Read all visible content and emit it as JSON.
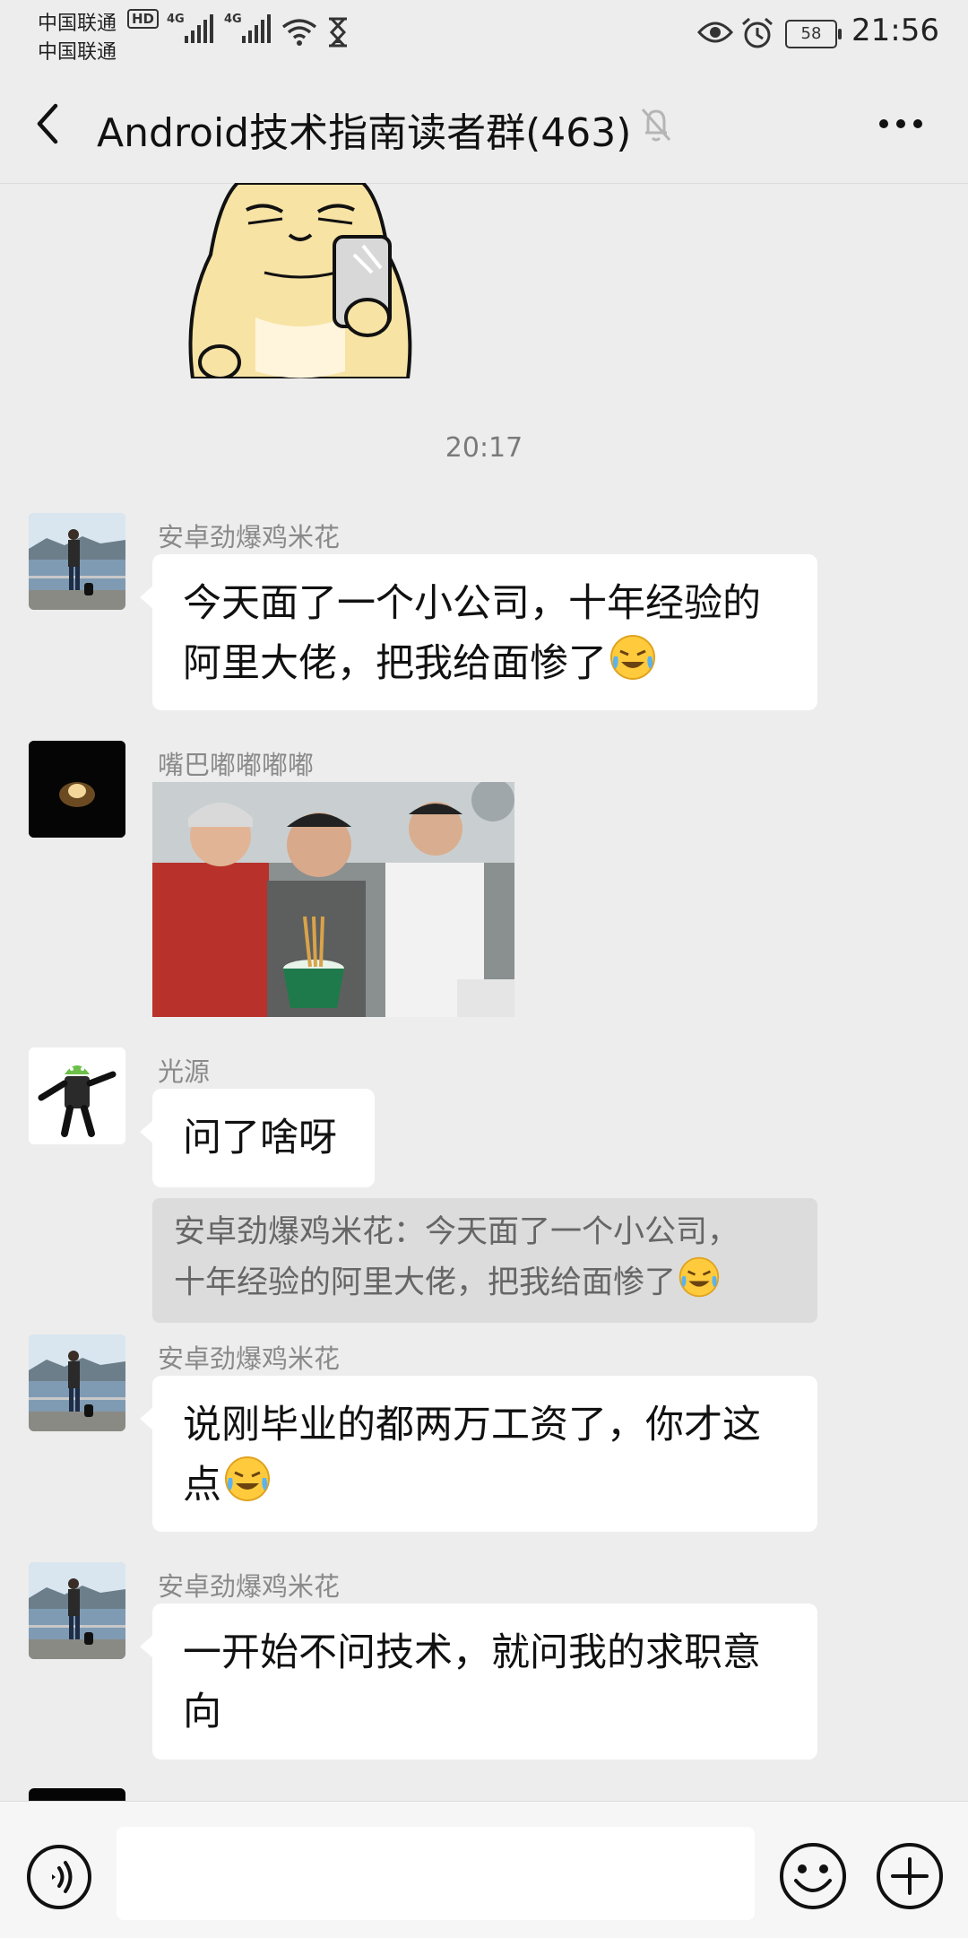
{
  "status_bar": {
    "carrier_1": "中国联通",
    "carrier_2": "中国联通",
    "hd_badge": "HD",
    "network_1": "4G",
    "network_2": "4G",
    "battery_level": "58",
    "time": "21:56",
    "icons": [
      "wifi-icon",
      "hourglass-icon",
      "eye-icon",
      "alarm-icon",
      "battery-icon"
    ]
  },
  "header": {
    "title": "Android技术指南读者群(463)",
    "icons": [
      "back-arrow-icon",
      "mute-bell-icon",
      "more-dots-icon"
    ]
  },
  "chat": {
    "timestamp": "20:17",
    "messages": [
      {
        "sender": "安卓劲爆鸡米花",
        "text_line1": "今天面了一个小公司，十年经验的",
        "text_line2": "阿里大佬，把我给面惨了"
      },
      {
        "sender": "嘴巴嘟嘟嘟嘟",
        "image": "photo-message"
      },
      {
        "sender": "光源",
        "text": "问了啥呀",
        "quote_line1": "安卓劲爆鸡米花：今天面了一个小公司，",
        "quote_line2": "十年经验的阿里大佬，把我给面惨了"
      },
      {
        "sender": "安卓劲爆鸡米花",
        "text_line1": "说刚毕业的都两万工资了，你才这",
        "text_line2": "点"
      },
      {
        "sender": "安卓劲爆鸡米花",
        "text_line1": "一开始不问技术，就问我的求职意",
        "text_line2": "向"
      }
    ]
  },
  "input_bar": {
    "text_value": "",
    "icons": [
      "voice-icon",
      "emoji-icon",
      "plus-icon"
    ]
  },
  "colors": {
    "background": "#ededed",
    "bubble": "#ffffff",
    "quote": "#dcdcdc",
    "nickname": "#8a8a8a",
    "timestamp": "#7a7a7a"
  }
}
